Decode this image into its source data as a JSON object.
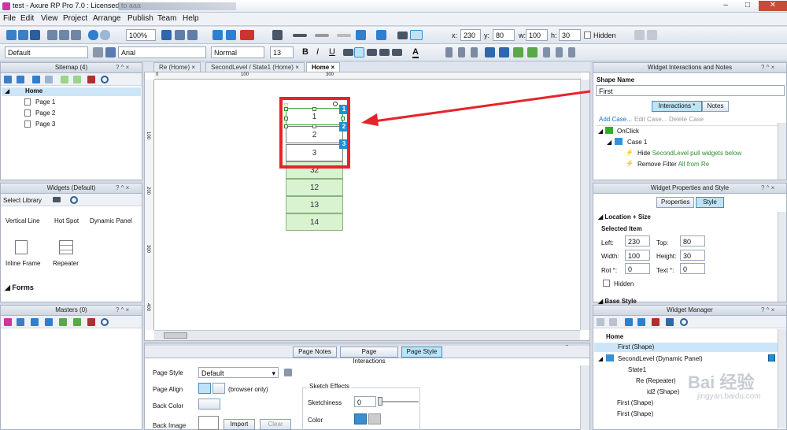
{
  "window": {
    "title": "test - Axure RP Pro 7.0 : Licensed to aaa",
    "minimize": "–",
    "maximize": "□",
    "close": "✕"
  },
  "menu": [
    "File",
    "Edit",
    "View",
    "Project",
    "Arrange",
    "Publish",
    "Team",
    "Help"
  ],
  "toolbar1": {
    "zoom": "100%",
    "x_label": "x:",
    "x": "230",
    "y_label": "y:",
    "y": "80",
    "w_label": "w:",
    "w": "100",
    "h_label": "h:",
    "h": "30",
    "hidden_label": "Hidden"
  },
  "toolbar2": {
    "style": "Default",
    "font": "Arial",
    "weight": "Normal",
    "size": "13",
    "bold": "B",
    "italic": "I",
    "underline": "U",
    "font_color": "A"
  },
  "sitemap": {
    "title": "Sitemap (4)",
    "controls": "? ^ ×",
    "pages": [
      {
        "label": "Home"
      },
      {
        "label": "Page 1"
      },
      {
        "label": "Page 2"
      },
      {
        "label": "Page 3"
      }
    ]
  },
  "widgets": {
    "title": "Widgets (Default)",
    "controls": "? ^ ×",
    "select_library": "Select Library",
    "items": [
      {
        "label": "Vertical Line"
      },
      {
        "label": "Hot Spot"
      },
      {
        "label": "Dynamic Panel"
      },
      {
        "label": "Inline Frame"
      },
      {
        "label": "Repeater"
      }
    ],
    "section_forms": "Forms"
  },
  "masters": {
    "title": "Masters (0)",
    "controls": "? ^ ×"
  },
  "doc_tabs": [
    {
      "label": "Re (Home)",
      "close": "×"
    },
    {
      "label": "SecondLevel / State1 (Home)",
      "close": "×"
    },
    {
      "label": "Home",
      "close": "×"
    }
  ],
  "ruler": {
    "h_ticks": [
      "0",
      "100",
      "200",
      "300",
      "400",
      "500",
      "600",
      "700"
    ],
    "v_ticks": [
      "100",
      "200",
      "300",
      "400"
    ]
  },
  "canvas": {
    "cells": [
      "1",
      "2",
      "3"
    ],
    "green_cells": [
      "32",
      "12",
      "13",
      "14"
    ],
    "badges": [
      "1",
      "2",
      "3"
    ]
  },
  "page_props": {
    "controls": "? ×",
    "tabs": [
      "Page Notes",
      "Page Interactions",
      "Page Style"
    ],
    "page_style_label": "Page Style",
    "page_style_value": "Default",
    "page_align_label": "Page Align",
    "browser_only": "(browser only)",
    "back_color_label": "Back Color",
    "back_image_label": "Back Image",
    "import_label": "Import",
    "clear_label": "Clear",
    "sketch_effects": "Sketch Effects",
    "sketchiness_label": "Sketchiness",
    "sketchiness_value": "0",
    "color_label": "Color"
  },
  "interactions": {
    "title": "Widget Interactions and Notes",
    "controls": "? ^ ×",
    "shape_name_label": "Shape Name",
    "shape_name": "First",
    "tabs": [
      "Interactions *",
      "Notes"
    ],
    "actions": [
      "Add Case...",
      "Edit Case...",
      "Delete Case"
    ],
    "tree": [
      {
        "label": "OnClick"
      },
      {
        "label": "Case 1"
      },
      {
        "label": "Hide ",
        "accent": "SecondLevel pull widgets below"
      },
      {
        "label": "Remove Filter ",
        "accent": "All from Re"
      }
    ]
  },
  "properties": {
    "title": "Widget Properties and Style",
    "controls": "? ^ ×",
    "tabs": [
      "Properties",
      "Style"
    ],
    "location_size": "Location + Size",
    "selected_item": "Selected Item",
    "left_label": "Left:",
    "left": "230",
    "top_label": "Top:",
    "top": "80",
    "width_label": "Width:",
    "width": "100",
    "height_label": "Height:",
    "height": "30",
    "rot_label": "Rot °:",
    "rot": "0",
    "text_label": "Text °:",
    "text": "0",
    "hidden_label": "Hidden",
    "base_style": "Base Style"
  },
  "manager": {
    "title": "Widget Manager",
    "controls": "? ^ ×",
    "items": [
      {
        "label": "Home"
      },
      {
        "label": "First (Shape)"
      },
      {
        "label": "SecondLevel (Dynamic Panel)"
      },
      {
        "label": "State1"
      },
      {
        "label": "Re (Repeater)"
      },
      {
        "label": "id2 (Shape)"
      },
      {
        "label": "First (Shape)"
      },
      {
        "label": "First (Shape)"
      }
    ]
  },
  "watermark": "Bai 经验",
  "watermark_url": "jingyan.baidu.com",
  "colors": {
    "accent": "#1f8fd6",
    "highlight": "#e8232a",
    "green_cell": "#d9f2d0",
    "selected": "#cde6f7"
  }
}
